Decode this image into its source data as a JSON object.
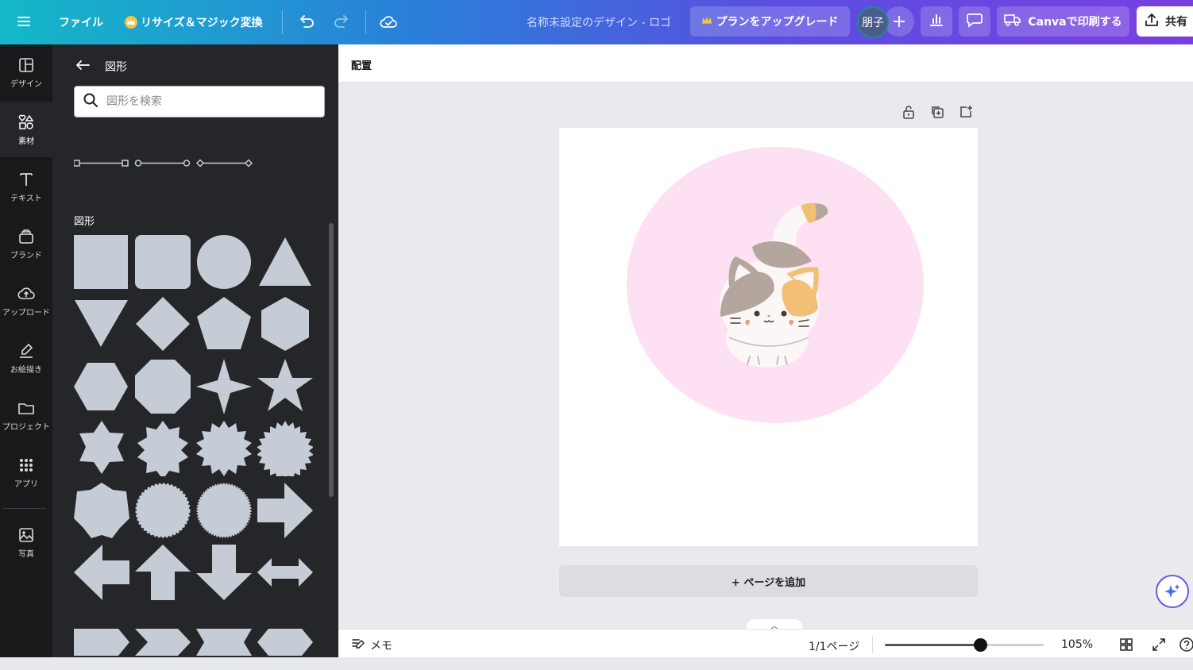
{
  "topbar": {
    "menu_icon": "hamburger-icon",
    "file_label": "ファイル",
    "resize_label": "リサイズ＆マジック変換",
    "design_title": "名称未設定のデザイン - ロゴ",
    "upgrade_label": "プランをアップグレード",
    "avatar_text": "朋子",
    "print_label": "Canvaで印刷する",
    "share_label": "共有"
  },
  "rail": {
    "items": [
      {
        "label": "デザイン",
        "icon": "layout-icon"
      },
      {
        "label": "素材",
        "icon": "elements-icon"
      },
      {
        "label": "テキスト",
        "icon": "text-icon"
      },
      {
        "label": "ブランド",
        "icon": "brand-icon"
      },
      {
        "label": "アップロード",
        "icon": "upload-icon"
      },
      {
        "label": "お絵描き",
        "icon": "draw-icon"
      },
      {
        "label": "プロジェクト",
        "icon": "folder-icon"
      },
      {
        "label": "アプリ",
        "icon": "apps-icon"
      },
      {
        "label": "写真",
        "icon": "photo-icon"
      }
    ],
    "active_index": 1
  },
  "panel": {
    "title": "図形",
    "search_placeholder": "図形を検索",
    "section_title": "図形",
    "shape_color": "#c5ccd6"
  },
  "workspace": {
    "context_label": "配置",
    "add_page_label": "+ ページを追加",
    "canvas_circle_color": "#fde0f2"
  },
  "bottombar": {
    "memo_label": "メモ",
    "pages_label": "1/1ページ",
    "zoom_label": "105%",
    "zoom_fraction": 0.6
  }
}
